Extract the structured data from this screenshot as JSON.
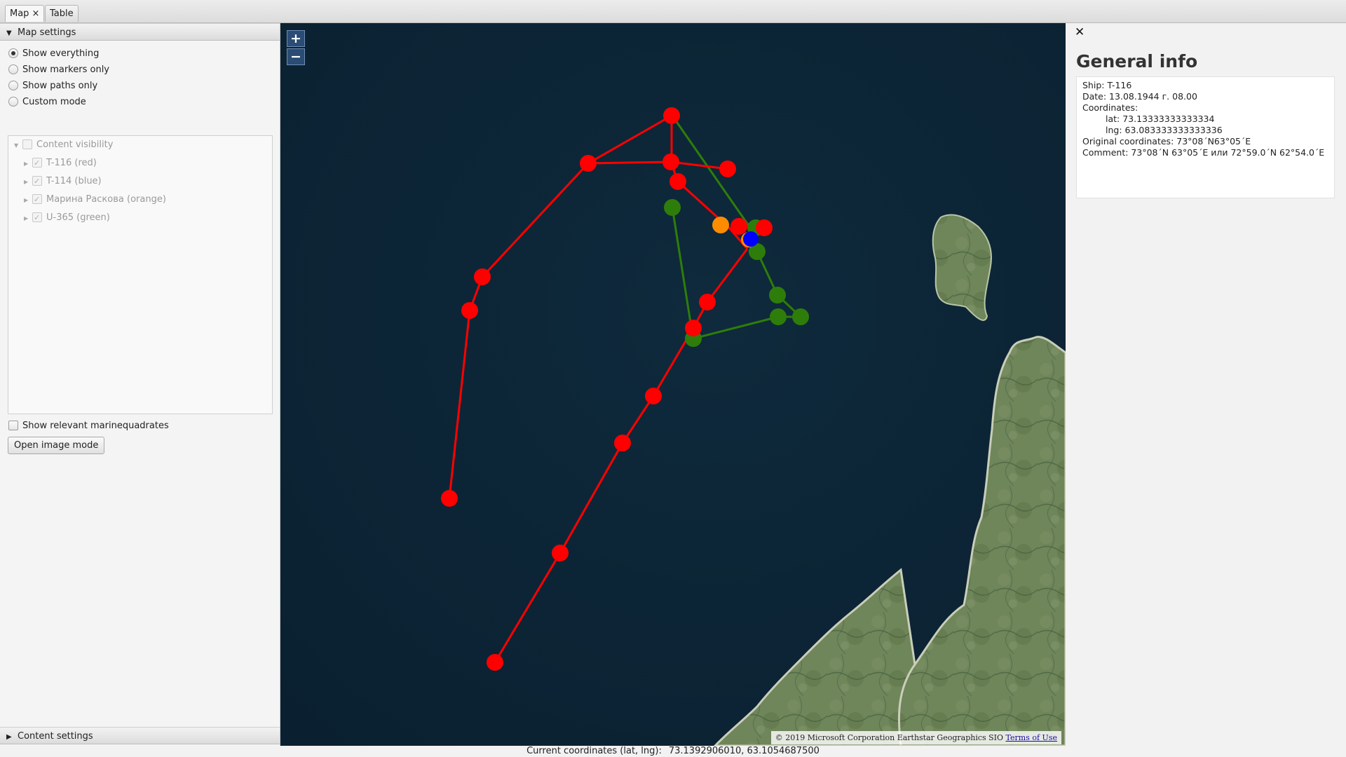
{
  "tabs": [
    {
      "label": "Map",
      "close_icon": "×",
      "active": true
    },
    {
      "label": "Table",
      "active": false
    }
  ],
  "left_panel": {
    "map_settings_title": "Map settings",
    "view_modes": [
      {
        "label": "Show everything",
        "selected": true
      },
      {
        "label": "Show markers only",
        "selected": false
      },
      {
        "label": "Show paths only",
        "selected": false
      },
      {
        "label": "Custom mode",
        "selected": false
      }
    ],
    "content_visibility": {
      "label": "Content visibility",
      "items": [
        {
          "label": "T-116 (red)",
          "checked": true
        },
        {
          "label": "T-114 (blue)",
          "checked": true
        },
        {
          "label": "Марина Раскова (orange)",
          "checked": true
        },
        {
          "label": "U-365 (green)",
          "checked": true
        }
      ]
    },
    "marinequadrates_label": "Show relevant marinequadrates",
    "marinequadrates_checked": false,
    "open_image_mode_label": "Open image mode",
    "content_settings_title": "Content settings"
  },
  "map": {
    "zoom_in_label": "+",
    "zoom_out_label": "−",
    "attribution_text": "© 2019 Microsoft Corporation Earthstar Geographics SIO",
    "terms_link": "Terms of Use",
    "colors": {
      "sea": "#0c2536",
      "land": "#6f855a",
      "red": "#ff0000",
      "green": "#2e7d0a",
      "orange": "#ff8c00",
      "blue": "#0000ff"
    }
  },
  "info_panel": {
    "close_icon": "✕",
    "title": "General info",
    "ship_line": "Ship: T-116",
    "date_line": "Date: 13.08.1944 г. 08.00",
    "coordinates_label": "Coordinates:",
    "lat_line": "lat: 73.13333333333334",
    "lng_line": "lng: 63.083333333333336",
    "original_line": "Original coordinates: 73°08´N63°05´E",
    "comment_line": "Comment: 73°08´N 63°05´E или 72°59.0´N 62°54.0´E"
  },
  "status_bar": {
    "label": "Current coordinates (lat, lng):",
    "value": "73.1392906010, 63.1054687500"
  }
}
